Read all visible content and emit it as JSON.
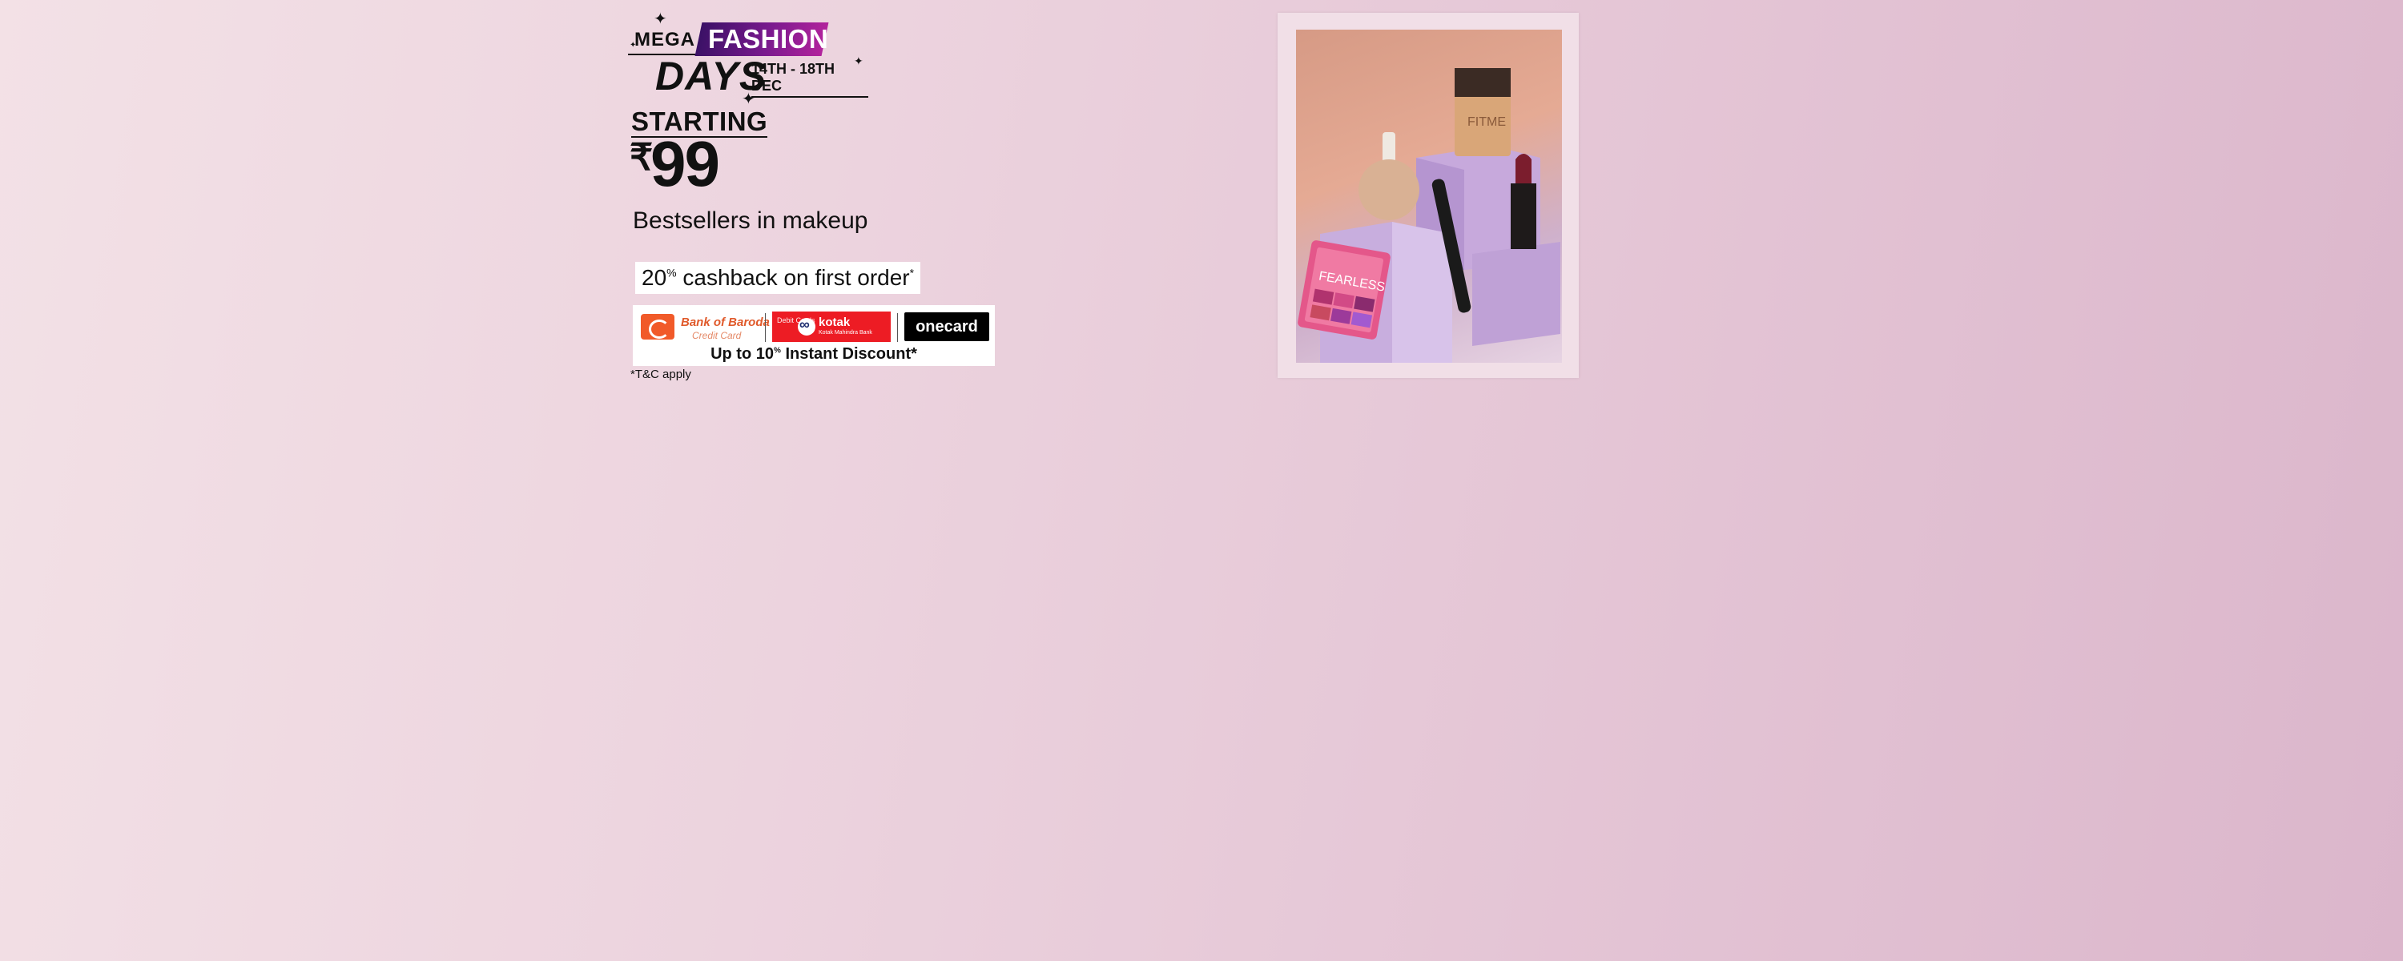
{
  "banner": {
    "logo": {
      "mega": "MEGA",
      "fashion": "FASHION",
      "days": "DAYS",
      "dates": "14TH - 18TH DEC"
    },
    "starting": "STARTING",
    "currency": "₹",
    "price": "99",
    "subtitle": "Bestsellers in makeup",
    "cashback": {
      "percent": "20",
      "percent_sign": "%",
      "text": " cashback on first order",
      "asterisk": "*"
    },
    "banks": {
      "bob_name": "Bank of Baroda",
      "bob_sub": "Credit Card",
      "kotak_debit": "Debit Cards",
      "kotak_name": "kotak",
      "kotak_sub": "Kotak Mahindra Bank",
      "onecard": "onecard",
      "offer_prefix": "Up to 10",
      "offer_percent": "%",
      "offer_suffix": " Instant Discount*"
    },
    "terms": "*T&C apply",
    "product_image": {
      "palette_text": "FEARLESS"
    }
  }
}
